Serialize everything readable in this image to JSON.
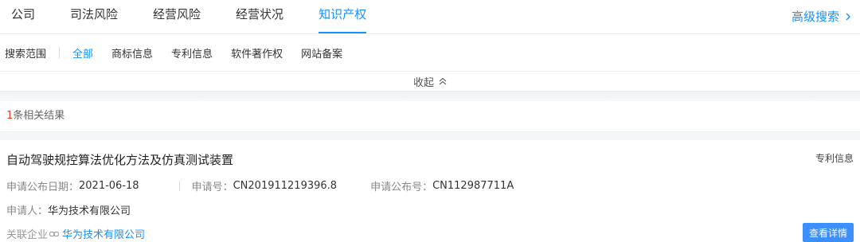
{
  "nav": {
    "tabs": [
      {
        "label": "公司",
        "active": false
      },
      {
        "label": "司法风险",
        "active": false
      },
      {
        "label": "经营风险",
        "active": false
      },
      {
        "label": "经营状况",
        "active": false
      },
      {
        "label": "知识产权",
        "active": true
      }
    ],
    "advanced_search": "高级搜索"
  },
  "filters": {
    "label": "搜索范围",
    "items": [
      "全部",
      "商标信息",
      "专利信息",
      "软件著作权",
      "网站备案"
    ],
    "active_index": 0
  },
  "collapse_label": "收起",
  "results": {
    "count": "1",
    "count_suffix": "条相关结果",
    "items": [
      {
        "title": "自动驾驶规控算法优化方法及仿真测试装置",
        "type": "专利信息",
        "pub_date_label": "申请公布日期：",
        "pub_date": "2021-06-18",
        "app_no_label": "申请号：",
        "app_no": "CN201911219396.8",
        "pub_no_label": "申请公布号：",
        "pub_no": "CN112987711A",
        "applicant_label": "申请人：",
        "applicant": "华为技术有限公司",
        "related_label": "关联企业",
        "related_company": "华为技术有限公司",
        "detail_button": "查看详情"
      }
    ]
  },
  "colors": {
    "accent": "#1890ff",
    "count_number": "#e6452a",
    "button": "#3c8ffd"
  },
  "icons": [
    "chevron-right-icon",
    "chevron-up-icon",
    "link-icon"
  ]
}
